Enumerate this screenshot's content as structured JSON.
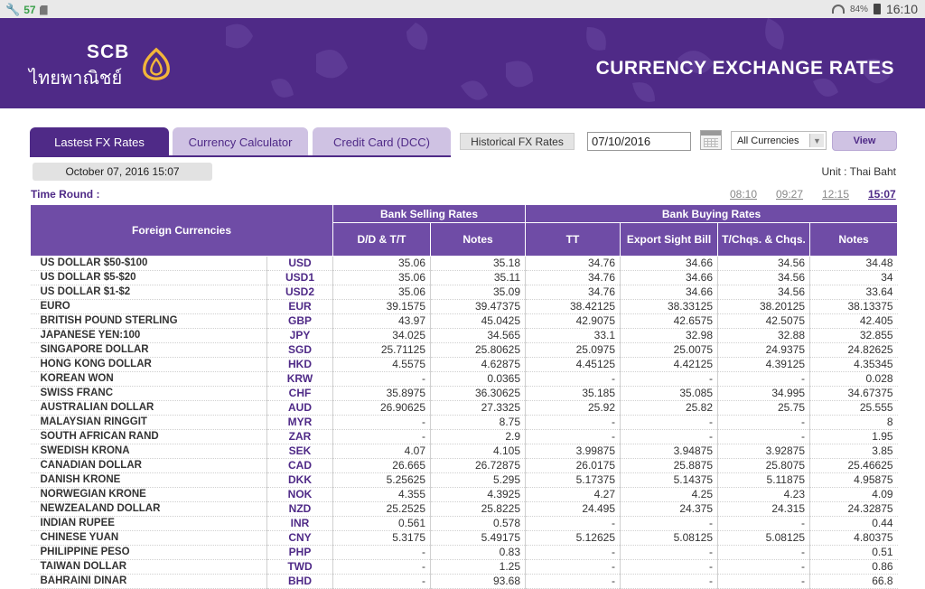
{
  "status_bar": {
    "notification_count": "57",
    "battery_percent": "84%",
    "time": "16:10"
  },
  "banner": {
    "logo_text": "SCB",
    "logo_thai": "ไทยพาณิชย์",
    "title": "CURRENCY EXCHANGE RATES"
  },
  "tabs": [
    {
      "label": "Lastest FX Rates",
      "active": true
    },
    {
      "label": "Currency Calculator",
      "active": false
    },
    {
      "label": "Credit Card (DCC)",
      "active": false
    }
  ],
  "controls": {
    "historical_label": "Historical FX Rates",
    "date_value": "07/10/2016",
    "currency_select": "All Currencies",
    "view_label": "View"
  },
  "info": {
    "date_time": "October 07, 2016 15:07",
    "unit": "Unit : Thai Baht",
    "time_round_label": "Time Round :",
    "rounds": [
      "08:10",
      "09:27",
      "12:15",
      "15:07"
    ],
    "active_round": "15:07"
  },
  "table": {
    "header_foreign": "Foreign Currencies",
    "header_selling": "Bank Selling Rates",
    "header_buying": "Bank Buying Rates",
    "subheaders": [
      "D/D & T/T",
      "Notes",
      "TT",
      "Export Sight Bill",
      "T/Chqs. & Chqs.",
      "Notes"
    ],
    "rows": [
      [
        "US DOLLAR $50-$100",
        "USD",
        "35.06",
        "35.18",
        "34.76",
        "34.66",
        "34.56",
        "34.48"
      ],
      [
        "US DOLLAR $5-$20",
        "USD1",
        "35.06",
        "35.11",
        "34.76",
        "34.66",
        "34.56",
        "34"
      ],
      [
        "US DOLLAR $1-$2",
        "USD2",
        "35.06",
        "35.09",
        "34.76",
        "34.66",
        "34.56",
        "33.64"
      ],
      [
        "EURO",
        "EUR",
        "39.1575",
        "39.47375",
        "38.42125",
        "38.33125",
        "38.20125",
        "38.13375"
      ],
      [
        "BRITISH POUND STERLING",
        "GBP",
        "43.97",
        "45.0425",
        "42.9075",
        "42.6575",
        "42.5075",
        "42.405"
      ],
      [
        "JAPANESE YEN:100",
        "JPY",
        "34.025",
        "34.565",
        "33.1",
        "32.98",
        "32.88",
        "32.855"
      ],
      [
        "SINGAPORE DOLLAR",
        "SGD",
        "25.71125",
        "25.80625",
        "25.0975",
        "25.0075",
        "24.9375",
        "24.82625"
      ],
      [
        "HONG KONG DOLLAR",
        "HKD",
        "4.5575",
        "4.62875",
        "4.45125",
        "4.42125",
        "4.39125",
        "4.35345"
      ],
      [
        "KOREAN WON",
        "KRW",
        "-",
        "0.0365",
        "-",
        "-",
        "-",
        "0.028"
      ],
      [
        "SWISS FRANC",
        "CHF",
        "35.8975",
        "36.30625",
        "35.185",
        "35.085",
        "34.995",
        "34.67375"
      ],
      [
        "AUSTRALIAN DOLLAR",
        "AUD",
        "26.90625",
        "27.3325",
        "25.92",
        "25.82",
        "25.75",
        "25.555"
      ],
      [
        "MALAYSIAN RINGGIT",
        "MYR",
        "-",
        "8.75",
        "-",
        "-",
        "-",
        "8"
      ],
      [
        "SOUTH AFRICAN RAND",
        "ZAR",
        "-",
        "2.9",
        "-",
        "-",
        "-",
        "1.95"
      ],
      [
        "SWEDISH KRONA",
        "SEK",
        "4.07",
        "4.105",
        "3.99875",
        "3.94875",
        "3.92875",
        "3.85"
      ],
      [
        "CANADIAN DOLLAR",
        "CAD",
        "26.665",
        "26.72875",
        "26.0175",
        "25.8875",
        "25.8075",
        "25.46625"
      ],
      [
        "DANISH KRONE",
        "DKK",
        "5.25625",
        "5.295",
        "5.17375",
        "5.14375",
        "5.11875",
        "4.95875"
      ],
      [
        "NORWEGIAN KRONE",
        "NOK",
        "4.355",
        "4.3925",
        "4.27",
        "4.25",
        "4.23",
        "4.09"
      ],
      [
        "NEWZEALAND DOLLAR",
        "NZD",
        "25.2525",
        "25.8225",
        "24.495",
        "24.375",
        "24.315",
        "24.32875"
      ],
      [
        "INDIAN RUPEE",
        "INR",
        "0.561",
        "0.578",
        "-",
        "-",
        "-",
        "0.44"
      ],
      [
        "CHINESE YUAN",
        "CNY",
        "5.3175",
        "5.49175",
        "5.12625",
        "5.08125",
        "5.08125",
        "4.80375"
      ],
      [
        "PHILIPPINE PESO",
        "PHP",
        "-",
        "0.83",
        "-",
        "-",
        "-",
        "0.51"
      ],
      [
        "TAIWAN DOLLAR",
        "TWD",
        "-",
        "1.25",
        "-",
        "-",
        "-",
        "0.86"
      ],
      [
        "BAHRAINI DINAR",
        "BHD",
        "-",
        "93.68",
        "-",
        "-",
        "-",
        "66.8"
      ]
    ]
  }
}
